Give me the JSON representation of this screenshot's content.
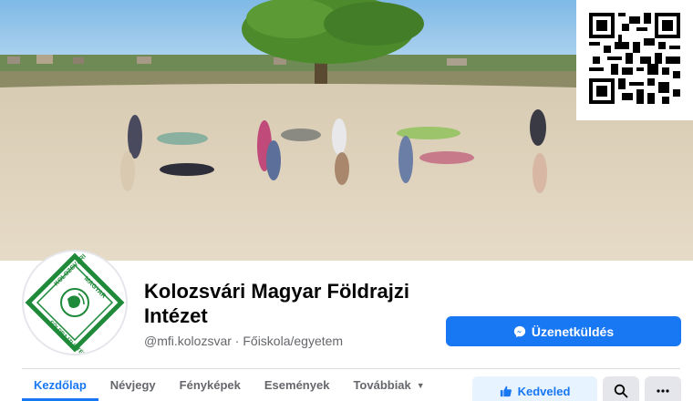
{
  "page": {
    "title": "Kolozsvári Magyar Földrajzi Intézet",
    "handle": "@mfi.kolozsvar",
    "separator": " · ",
    "category": "Főiskola/egyetem"
  },
  "cover": {
    "description_icon": "cover-photo",
    "sky_color": "#8fc3ea",
    "sand_color": "#e0d3bc"
  },
  "logo": {
    "top_text": "KOLOZSVÁRI",
    "right_text": "MAGYAR",
    "bottom_text": "FÖLDRAJZI INTÉZET",
    "brand_color": "#1f8a3a"
  },
  "actions": {
    "message_label": "Üzenetküldés",
    "like_label": "Kedveled",
    "search_icon": "search-icon",
    "more_icon": "more-icon"
  },
  "tabs": [
    {
      "label": "Kezdőlap",
      "active": true
    },
    {
      "label": "Névjegy"
    },
    {
      "label": "Fényképek"
    },
    {
      "label": "Események"
    },
    {
      "label": "Továbbiak"
    }
  ],
  "colors": {
    "accent": "#1877f2",
    "accent_light": "#e7f3ff",
    "text_primary": "#050505",
    "text_secondary": "#65676b"
  }
}
